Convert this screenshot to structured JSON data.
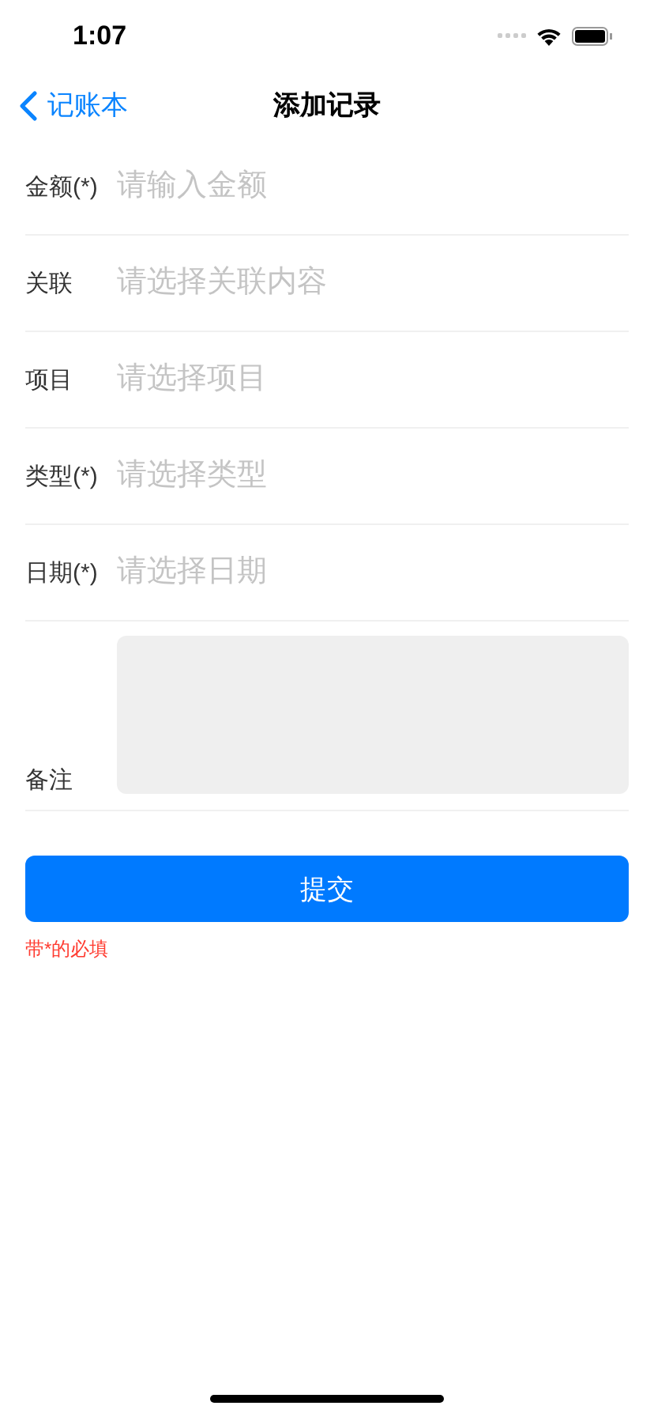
{
  "status_bar": {
    "time": "1:07"
  },
  "nav": {
    "back": "记账本",
    "title": "添加记录"
  },
  "fields": [
    {
      "kind": "input",
      "label": "金额(*)",
      "placeholder": "请输入金额"
    },
    {
      "kind": "input",
      "label": "关联",
      "placeholder": "请选择关联内容"
    },
    {
      "kind": "input",
      "label": "项目",
      "placeholder": "请选择项目"
    },
    {
      "kind": "input",
      "label": "类型(*)",
      "placeholder": "请选择类型"
    },
    {
      "kind": "input",
      "label": "日期(*)",
      "placeholder": "请选择日期"
    },
    {
      "kind": "textarea",
      "label": "备注"
    }
  ],
  "submit": "提交",
  "note": "带*的必填"
}
